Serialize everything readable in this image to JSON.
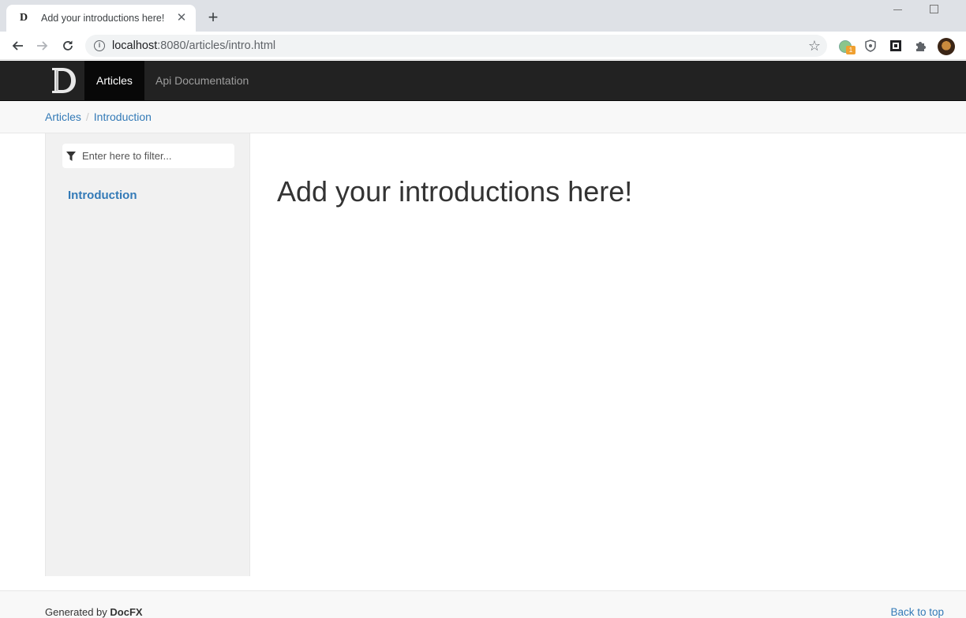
{
  "browser": {
    "tab_title": "Add your introductions here!",
    "tab_favicon": "D",
    "close_glyph": "✕",
    "new_tab_glyph": "+",
    "url_host": "localhost",
    "url_rest": ":8080/articles/intro.html",
    "extension_badge": "1",
    "icons": [
      "back-icon",
      "forward-icon",
      "reload-icon",
      "info-icon",
      "star-icon",
      "extension-icon",
      "shield-icon",
      "qr-icon",
      "puzzle-icon",
      "avatar"
    ]
  },
  "navbar": {
    "items": [
      {
        "label": "Articles",
        "active": true
      },
      {
        "label": "Api Documentation",
        "active": false
      }
    ]
  },
  "breadcrumb": {
    "items": [
      "Articles",
      "Introduction"
    ],
    "separator": "/"
  },
  "sidebar": {
    "filter_placeholder": "Enter here to filter...",
    "toc": [
      "Introduction"
    ]
  },
  "article": {
    "title": "Add your introductions here!"
  },
  "footer": {
    "generated_prefix": "Generated by ",
    "generator": "DocFX",
    "back_to_top": "Back to top"
  },
  "colors": {
    "navbar_bg": "#222222",
    "link": "#337ab7",
    "sidebar_bg": "#f1f1f1"
  }
}
